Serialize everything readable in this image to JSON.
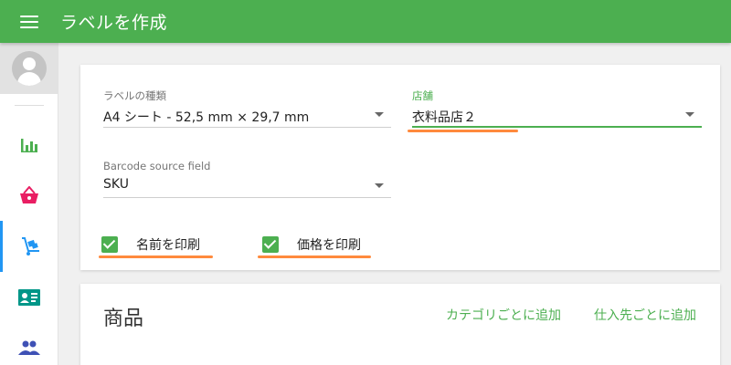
{
  "header": {
    "title": "ラベルを作成"
  },
  "sidebar": {
    "items": [
      {
        "name": "stats",
        "color": "#4caf50"
      },
      {
        "name": "basket",
        "color": "#e91e63"
      },
      {
        "name": "cart",
        "color": "#2196f3",
        "active": true
      },
      {
        "name": "card",
        "color": "#009688"
      },
      {
        "name": "people",
        "color": "#3f51b5"
      }
    ]
  },
  "form": {
    "label_type": {
      "label": "ラベルの種類",
      "value": "A4 シート - 52,5 mm × 29,7 mm"
    },
    "store": {
      "label": "店舗",
      "value": "衣料品店２"
    },
    "barcode": {
      "label": "Barcode source field",
      "value": "SKU"
    },
    "print_name": {
      "label": "名前を印刷",
      "checked": true
    },
    "print_price": {
      "label": "価格を印刷",
      "checked": true
    }
  },
  "products": {
    "title": "商品",
    "add_by_category": "カテゴリごとに追加",
    "add_by_supplier": "仕入先ごとに追加"
  },
  "colors": {
    "primary": "#4caf50",
    "accent": "#2196f3",
    "highlight": "#ff8a3d"
  }
}
